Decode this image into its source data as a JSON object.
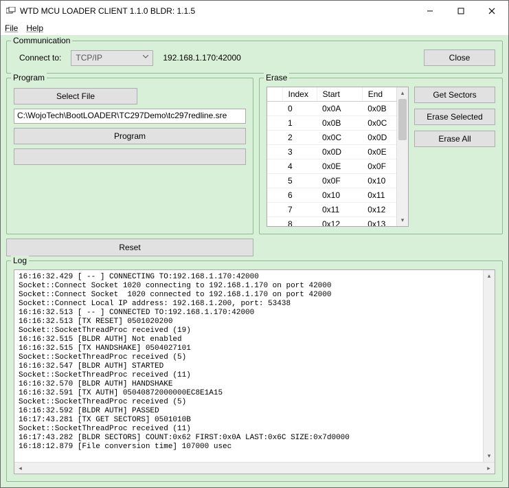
{
  "window": {
    "title": "WTD MCU LOADER CLIENT 1.1.0 BLDR: 1.1.5"
  },
  "menu": {
    "file": "File",
    "help": "Help"
  },
  "communication": {
    "group_title": "Communication",
    "connect_to_label": "Connect to:",
    "protocol": "TCP/IP",
    "address": "192.168.1.170:42000",
    "close_label": "Close"
  },
  "program": {
    "group_title": "Program",
    "select_file_label": "Select File",
    "file_path": "C:\\WojoTech\\BootLOADER\\TC297Demo\\tc297redline.sre",
    "program_label": "Program",
    "reset_label": "Reset"
  },
  "erase": {
    "group_title": "Erase",
    "columns": {
      "index": "Index",
      "start": "Start",
      "end": "End"
    },
    "rows": [
      {
        "index": "0",
        "start": "0x0A",
        "end": "0x0B"
      },
      {
        "index": "1",
        "start": "0x0B",
        "end": "0x0C"
      },
      {
        "index": "2",
        "start": "0x0C",
        "end": "0x0D"
      },
      {
        "index": "3",
        "start": "0x0D",
        "end": "0x0E"
      },
      {
        "index": "4",
        "start": "0x0E",
        "end": "0x0F"
      },
      {
        "index": "5",
        "start": "0x0F",
        "end": "0x10"
      },
      {
        "index": "6",
        "start": "0x10",
        "end": "0x11"
      },
      {
        "index": "7",
        "start": "0x11",
        "end": "0x12"
      },
      {
        "index": "8",
        "start": "0x12",
        "end": "0x13"
      }
    ],
    "get_sectors_label": "Get Sectors",
    "erase_selected_label": "Erase Selected",
    "erase_all_label": "Erase All"
  },
  "log": {
    "group_title": "Log",
    "lines": [
      "16:16:32.429 [ -- ] CONNECTING TO:192.168.1.170:42000",
      "Socket::Connect Socket 1020 connecting to 192.168.1.170 on port 42000",
      "Socket::Connect Socket  1020 connected to 192.168.1.170 on port 42000",
      "Socket::Connect Local IP address: 192.168.1.200, port: 53438",
      "16:16:32.513 [ -- ] CONNECTED TO:192.168.1.170:42000",
      "16:16:32.513 [TX RESET] 0501020200",
      "Socket::SocketThreadProc received (19)",
      "16:16:32.515 [BLDR AUTH] Not enabled",
      "16:16:32.515 [TX HANDSHAKE] 0504027101",
      "Socket::SocketThreadProc received (5)",
      "16:16:32.547 [BLDR AUTH] STARTED",
      "Socket::SocketThreadProc received (11)",
      "16:16:32.570 [BLDR AUTH] HANDSHAKE",
      "16:16:32.591 [TX AUTH] 05040872000000EC8E1A15",
      "Socket::SocketThreadProc received (5)",
      "16:16:32.592 [BLDR AUTH] PASSED",
      "16:17:43.281 [TX GET SECTORS] 0501010B",
      "Socket::SocketThreadProc received (11)",
      "16:17:43.282 [BLDR SECTORS] COUNT:0x62 FIRST:0x0A LAST:0x6C SIZE:0x7d0000",
      "16:18:12.879 [File conversion time] 107000 usec"
    ]
  }
}
